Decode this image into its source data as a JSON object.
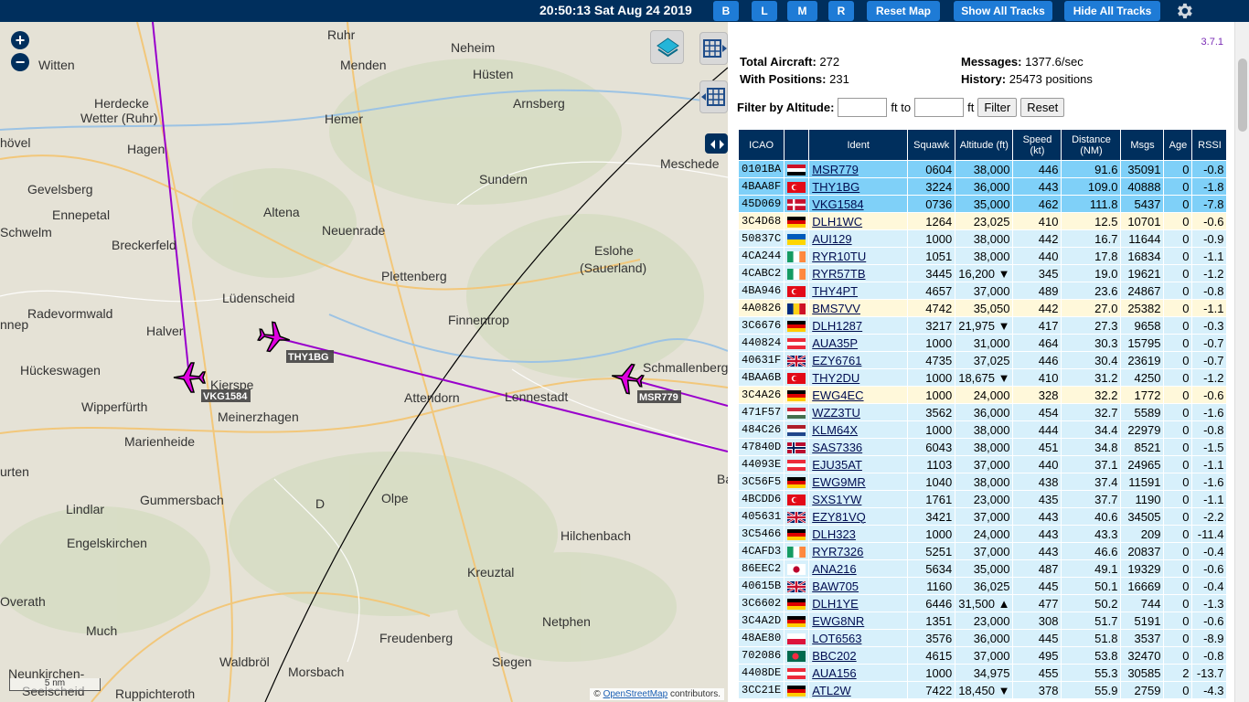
{
  "header": {
    "clock": "20:50:13 Sat Aug 24 2019",
    "buttons": [
      {
        "label": "B"
      },
      {
        "label": "L"
      },
      {
        "label": "M"
      },
      {
        "label": "R"
      },
      {
        "label": "Reset Map"
      },
      {
        "label": "Show All Tracks"
      },
      {
        "label": "Hide All Tracks"
      }
    ],
    "settings_icon": "gear-icon"
  },
  "map": {
    "zoom_in": "+",
    "zoom_out": "−",
    "scale_label": "5 nm",
    "attribution_prefix": "©",
    "attribution_link": "OpenStreetMap",
    "attribution_suffix": "contributors.",
    "towns": [
      "Ruhr",
      "Neheim",
      "Witten",
      "Menden",
      "Hüsten",
      "Herdecke",
      "Wetter (Ruhr)",
      "Arnsberg",
      "Hemer",
      "Meschede",
      "hövel",
      "Hagen",
      "Gevelsberg",
      "Sundern",
      "Ennepetal",
      "Altena",
      "Schwelm",
      "Neuenrade",
      "Breckerfeld",
      "Eslohe",
      "(Sauerland)",
      "Lüdenscheid",
      "Plettenberg",
      "Radevormwald",
      "Halver",
      "Finnentrop",
      "Schmallenberg",
      "nnep",
      "Hückeswagen",
      "Kierspe",
      "Attendorn",
      "Lennestadt",
      "Wipperfürth",
      "Meinerzhagen",
      "Marienheide",
      "urten",
      "Gummersbach",
      "D",
      "Olpe",
      "Lindlar",
      "Engelskirchen",
      "Hilchenbach",
      "Kreuztal",
      "Overath",
      "Much",
      "Netphen",
      "Freudenberg",
      "Neunkirchen-",
      "Seelscheid",
      "Waldbröl",
      "Morsbach",
      "Siegen",
      "Ruppichteroth",
      "Ba"
    ],
    "aircraft": [
      {
        "label": "VKG1584",
        "color": "#e000e0"
      },
      {
        "label": "THY1BG",
        "color": "#e000e0"
      },
      {
        "label": "MSR779",
        "color": "#e000e0"
      }
    ],
    "track_color": "#9900cc",
    "range_ring_color": "#000000"
  },
  "panel": {
    "version": "3.7.1",
    "total_aircraft_label": "Total Aircraft:",
    "total_aircraft": "272",
    "with_positions_label": "With Positions:",
    "with_positions": "231",
    "messages_label": "Messages:",
    "messages": "1377.6/sec",
    "history_label": "History:",
    "history": "25473 positions",
    "filter_label": "Filter by Altitude:",
    "filter_to": "ft to",
    "filter_unit": "ft",
    "filter_button": "Filter",
    "reset_button": "Reset"
  },
  "table": {
    "columns": [
      "ICAO",
      "",
      "Ident",
      "Squawk",
      "Altitude (ft)",
      "Speed (kt)",
      "Distance (NM)",
      "Msgs",
      "Age",
      "RSSI"
    ],
    "rows": [
      {
        "icao": "0101BA",
        "flag": "EG",
        "ident": "MSR779",
        "squawk": "0604",
        "alt": "38,000",
        "speed": "446",
        "dist": "91.6",
        "msgs": "35091",
        "age": "0",
        "rssi": "-0.8",
        "style": "sel"
      },
      {
        "icao": "4BAA8F",
        "flag": "TR",
        "ident": "THY1BG",
        "squawk": "3224",
        "alt": "36,000",
        "speed": "443",
        "dist": "109.0",
        "msgs": "40888",
        "age": "0",
        "rssi": "-1.8",
        "style": "sel"
      },
      {
        "icao": "45D069",
        "flag": "DK",
        "ident": "VKG1584",
        "squawk": "0736",
        "alt": "35,000",
        "speed": "462",
        "dist": "111.8",
        "msgs": "5437",
        "age": "0",
        "rssi": "-7.8",
        "style": "sel"
      },
      {
        "icao": "3C4D68",
        "flag": "DE",
        "ident": "DLH1WC",
        "squawk": "1264",
        "alt": "23,025",
        "speed": "410",
        "dist": "12.5",
        "msgs": "10701",
        "age": "0",
        "rssi": "-0.6",
        "style": "ground"
      },
      {
        "icao": "50837C",
        "flag": "UA",
        "ident": "AUI129",
        "squawk": "1000",
        "alt": "38,000",
        "speed": "442",
        "dist": "16.7",
        "msgs": "11644",
        "age": "0",
        "rssi": "-0.9",
        "style": "plain"
      },
      {
        "icao": "4CA244",
        "flag": "IE",
        "ident": "RYR10TU",
        "squawk": "1051",
        "alt": "38,000",
        "speed": "440",
        "dist": "17.8",
        "msgs": "16834",
        "age": "0",
        "rssi": "-1.1",
        "style": "plain"
      },
      {
        "icao": "4CABC2",
        "flag": "IE",
        "ident": "RYR57TB",
        "squawk": "3445",
        "alt": "16,200 ▼",
        "speed": "345",
        "dist": "19.0",
        "msgs": "19621",
        "age": "0",
        "rssi": "-1.2",
        "style": "plain"
      },
      {
        "icao": "4BA946",
        "flag": "TR",
        "ident": "THY4PT",
        "squawk": "4657",
        "alt": "37,000",
        "speed": "489",
        "dist": "23.6",
        "msgs": "24867",
        "age": "0",
        "rssi": "-0.8",
        "style": "plain"
      },
      {
        "icao": "4A0826",
        "flag": "RO",
        "ident": "BMS7VV",
        "squawk": "4742",
        "alt": "35,050",
        "speed": "442",
        "dist": "27.0",
        "msgs": "25382",
        "age": "0",
        "rssi": "-1.1",
        "style": "ground"
      },
      {
        "icao": "3C6676",
        "flag": "DE",
        "ident": "DLH1287",
        "squawk": "3217",
        "alt": "21,975 ▼",
        "speed": "417",
        "dist": "27.3",
        "msgs": "9658",
        "age": "0",
        "rssi": "-0.3",
        "style": "plain"
      },
      {
        "icao": "440824",
        "flag": "AT",
        "ident": "AUA35P",
        "squawk": "1000",
        "alt": "31,000",
        "speed": "464",
        "dist": "30.3",
        "msgs": "15795",
        "age": "0",
        "rssi": "-0.7",
        "style": "plain"
      },
      {
        "icao": "40631F",
        "flag": "GB",
        "ident": "EZY6761",
        "squawk": "4735",
        "alt": "37,025",
        "speed": "446",
        "dist": "30.4",
        "msgs": "23619",
        "age": "0",
        "rssi": "-0.7",
        "style": "plain"
      },
      {
        "icao": "4BAA6B",
        "flag": "TR",
        "ident": "THY2DU",
        "squawk": "1000",
        "alt": "18,675 ▼",
        "speed": "410",
        "dist": "31.2",
        "msgs": "4250",
        "age": "0",
        "rssi": "-1.2",
        "style": "plain"
      },
      {
        "icao": "3C4A26",
        "flag": "DE",
        "ident": "EWG4EC",
        "squawk": "1000",
        "alt": "24,000",
        "speed": "328",
        "dist": "32.2",
        "msgs": "1772",
        "age": "0",
        "rssi": "-0.6",
        "style": "ground"
      },
      {
        "icao": "471F57",
        "flag": "HU",
        "ident": "WZZ3TU",
        "squawk": "3562",
        "alt": "36,000",
        "speed": "454",
        "dist": "32.7",
        "msgs": "5589",
        "age": "0",
        "rssi": "-1.6",
        "style": "plain"
      },
      {
        "icao": "484C26",
        "flag": "NL",
        "ident": "KLM64X",
        "squawk": "1000",
        "alt": "38,000",
        "speed": "444",
        "dist": "34.4",
        "msgs": "22979",
        "age": "0",
        "rssi": "-0.8",
        "style": "plain"
      },
      {
        "icao": "47840D",
        "flag": "NO",
        "ident": "SAS7336",
        "squawk": "6043",
        "alt": "38,000",
        "speed": "451",
        "dist": "34.8",
        "msgs": "8521",
        "age": "0",
        "rssi": "-1.5",
        "style": "plain"
      },
      {
        "icao": "44093E",
        "flag": "AT",
        "ident": "EJU35AT",
        "squawk": "1103",
        "alt": "37,000",
        "speed": "440",
        "dist": "37.1",
        "msgs": "24965",
        "age": "0",
        "rssi": "-1.1",
        "style": "plain"
      },
      {
        "icao": "3C56F5",
        "flag": "DE",
        "ident": "EWG9MR",
        "squawk": "1040",
        "alt": "38,000",
        "speed": "438",
        "dist": "37.4",
        "msgs": "11591",
        "age": "0",
        "rssi": "-1.6",
        "style": "plain"
      },
      {
        "icao": "4BCDD6",
        "flag": "TR",
        "ident": "SXS1YW",
        "squawk": "1761",
        "alt": "23,000",
        "speed": "435",
        "dist": "37.7",
        "msgs": "1190",
        "age": "0",
        "rssi": "-1.1",
        "style": "plain"
      },
      {
        "icao": "405631",
        "flag": "GB",
        "ident": "EZY81VQ",
        "squawk": "3421",
        "alt": "37,000",
        "speed": "443",
        "dist": "40.6",
        "msgs": "34505",
        "age": "0",
        "rssi": "-2.2",
        "style": "plain"
      },
      {
        "icao": "3C5466",
        "flag": "DE",
        "ident": "DLH323",
        "squawk": "1000",
        "alt": "24,000",
        "speed": "443",
        "dist": "43.3",
        "msgs": "209",
        "age": "0",
        "rssi": "-11.4",
        "style": "plain"
      },
      {
        "icao": "4CAFD3",
        "flag": "IE",
        "ident": "RYR7326",
        "squawk": "5251",
        "alt": "37,000",
        "speed": "443",
        "dist": "46.6",
        "msgs": "20837",
        "age": "0",
        "rssi": "-0.4",
        "style": "plain"
      },
      {
        "icao": "86EEC2",
        "flag": "JP",
        "ident": "ANA216",
        "squawk": "5634",
        "alt": "35,000",
        "speed": "487",
        "dist": "49.1",
        "msgs": "19329",
        "age": "0",
        "rssi": "-0.6",
        "style": "plain"
      },
      {
        "icao": "40615B",
        "flag": "GB",
        "ident": "BAW705",
        "squawk": "1160",
        "alt": "36,025",
        "speed": "445",
        "dist": "50.1",
        "msgs": "16669",
        "age": "0",
        "rssi": "-0.4",
        "style": "plain"
      },
      {
        "icao": "3C6602",
        "flag": "DE",
        "ident": "DLH1YE",
        "squawk": "6446",
        "alt": "31,500 ▲",
        "speed": "477",
        "dist": "50.2",
        "msgs": "744",
        "age": "0",
        "rssi": "-1.3",
        "style": "plain"
      },
      {
        "icao": "3C4A2D",
        "flag": "DE",
        "ident": "EWG8NR",
        "squawk": "1351",
        "alt": "23,000",
        "speed": "308",
        "dist": "51.7",
        "msgs": "5191",
        "age": "0",
        "rssi": "-0.6",
        "style": "plain"
      },
      {
        "icao": "48AE80",
        "flag": "PL",
        "ident": "LOT6563",
        "squawk": "3576",
        "alt": "36,000",
        "speed": "445",
        "dist": "51.8",
        "msgs": "3537",
        "age": "0",
        "rssi": "-8.9",
        "style": "plain"
      },
      {
        "icao": "702086",
        "flag": "BD",
        "ident": "BBC202",
        "squawk": "4615",
        "alt": "37,000",
        "speed": "495",
        "dist": "53.8",
        "msgs": "32470",
        "age": "0",
        "rssi": "-0.8",
        "style": "plain"
      },
      {
        "icao": "4408DE",
        "flag": "AT",
        "ident": "AUA156",
        "squawk": "1000",
        "alt": "34,975",
        "speed": "455",
        "dist": "55.3",
        "msgs": "30585",
        "age": "2",
        "rssi": "-13.7",
        "style": "plain"
      },
      {
        "icao": "3CC21E",
        "flag": "DE",
        "ident": "ATL2W",
        "squawk": "7422",
        "alt": "18,450 ▼",
        "speed": "378",
        "dist": "55.9",
        "msgs": "2759",
        "age": "0",
        "rssi": "-4.3",
        "style": "plain"
      }
    ]
  }
}
